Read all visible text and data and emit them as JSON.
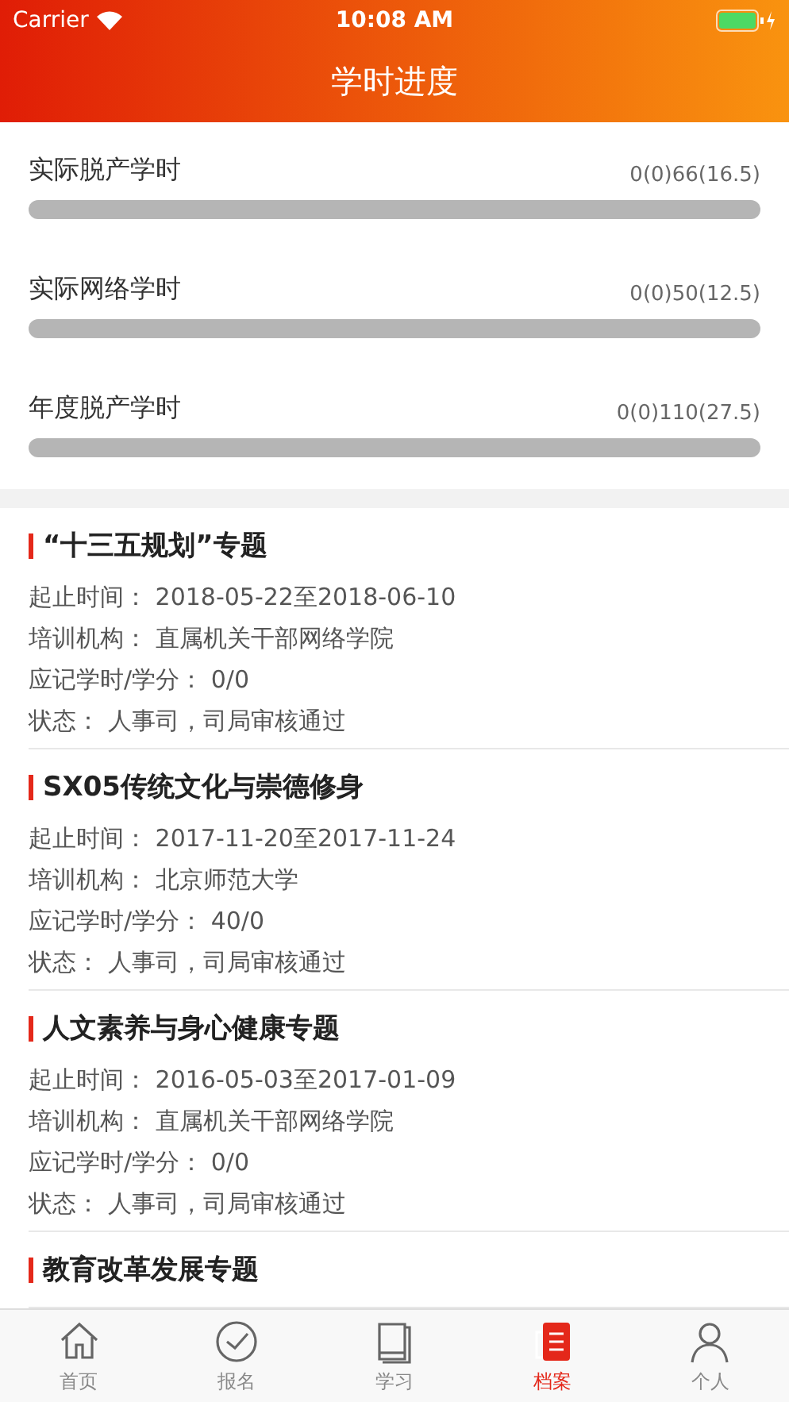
{
  "status_bar": {
    "carrier": "Carrier",
    "time": "10:08 AM"
  },
  "nav": {
    "title": "学时进度"
  },
  "progress": [
    {
      "label": "实际脱产学时",
      "reading": "0(0)66(16.5)",
      "level": 0
    },
    {
      "label": "实际网络学时",
      "reading": "0(0)50(12.5)",
      "level": 0
    },
    {
      "label": "年度脱产学时",
      "reading": "0(0)110(27.5)",
      "level": 0
    }
  ],
  "courses": [
    {
      "title": "“十三五规划”专题",
      "fields": [
        {
          "label": "起止时间：",
          "value": "2018-05-22至2018-06-10"
        },
        {
          "label": "培训机构：",
          "value": "直属机关干部网络学院"
        },
        {
          "label": "应记学时/学分：",
          "value": "0/0"
        },
        {
          "label": "状态：",
          "value": "人事司，司局审核通过"
        }
      ]
    },
    {
      "title": "SX05传统文化与崇德修身",
      "fields": [
        {
          "label": "起止时间：",
          "value": "2017-11-20至2017-11-24"
        },
        {
          "label": "培训机构：",
          "value": "北京师范大学"
        },
        {
          "label": "应记学时/学分：",
          "value": "40/0"
        },
        {
          "label": "状态：",
          "value": "人事司，司局审核通过"
        }
      ]
    },
    {
      "title": "人文素养与身心健康专题",
      "fields": [
        {
          "label": "起止时间：",
          "value": "2016-05-03至2017-01-09"
        },
        {
          "label": "培训机构：",
          "value": "直属机关干部网络学院"
        },
        {
          "label": "应记学时/学分：",
          "value": "0/0"
        },
        {
          "label": "状态：",
          "value": "人事司，司局审核通过"
        }
      ]
    },
    {
      "title": "教育改革发展专题"
    }
  ],
  "tab_bar": [
    {
      "label": "首页",
      "kind": "home",
      "selected": false
    },
    {
      "label": "报名",
      "kind": "check",
      "selected": false
    },
    {
      "label": "学习",
      "kind": "book",
      "selected": false
    },
    {
      "label": "档案",
      "kind": "file",
      "selected": true
    },
    {
      "label": "个人",
      "kind": "person",
      "selected": false
    }
  ]
}
